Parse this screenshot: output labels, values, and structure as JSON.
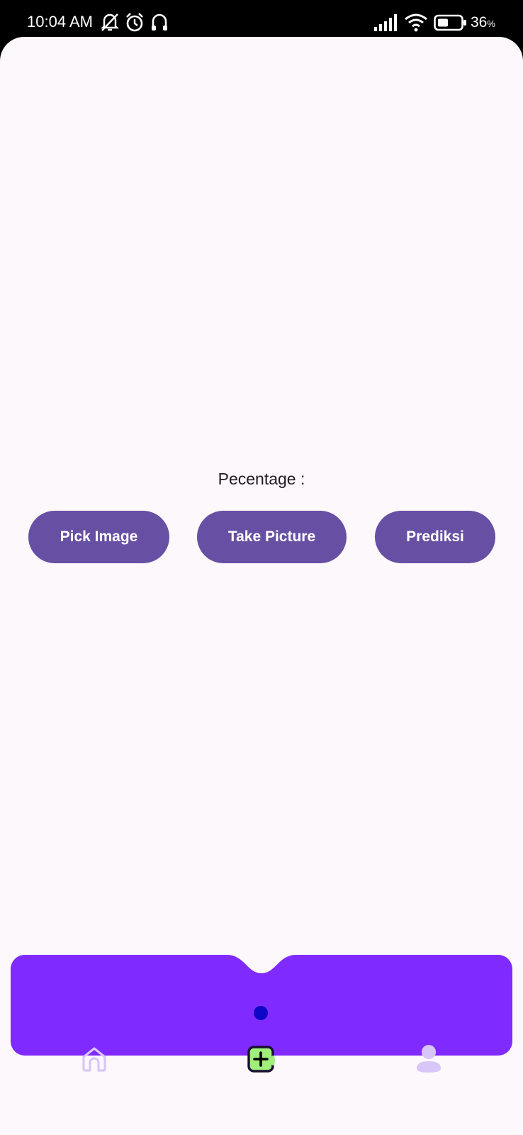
{
  "status_bar": {
    "time": "10:04 AM",
    "battery_percent": "36",
    "battery_unit": "%",
    "icons": [
      "bell-off-icon",
      "alarm-icon",
      "headset-icon",
      "signal-icon",
      "wifi-icon",
      "battery-icon"
    ]
  },
  "main": {
    "percentage_label": "Pecentage  :",
    "buttons": {
      "pick_image": "Pick Image",
      "take_picture": "Take Picture",
      "prediksi": "Prediksi"
    }
  },
  "bottom_nav": {
    "items": [
      {
        "name": "home",
        "icon": "home-icon"
      },
      {
        "name": "add",
        "icon": "add-icon",
        "selected": true
      },
      {
        "name": "profile",
        "icon": "person-icon"
      }
    ],
    "indicator_color": "#0f07c8"
  },
  "colors": {
    "primary_button": "#6750a4",
    "nav_background": "#7f2bff",
    "nav_icon": "#d9c6f8",
    "add_icon_fill": "#9ef07a",
    "background": "#fdf8fb"
  }
}
